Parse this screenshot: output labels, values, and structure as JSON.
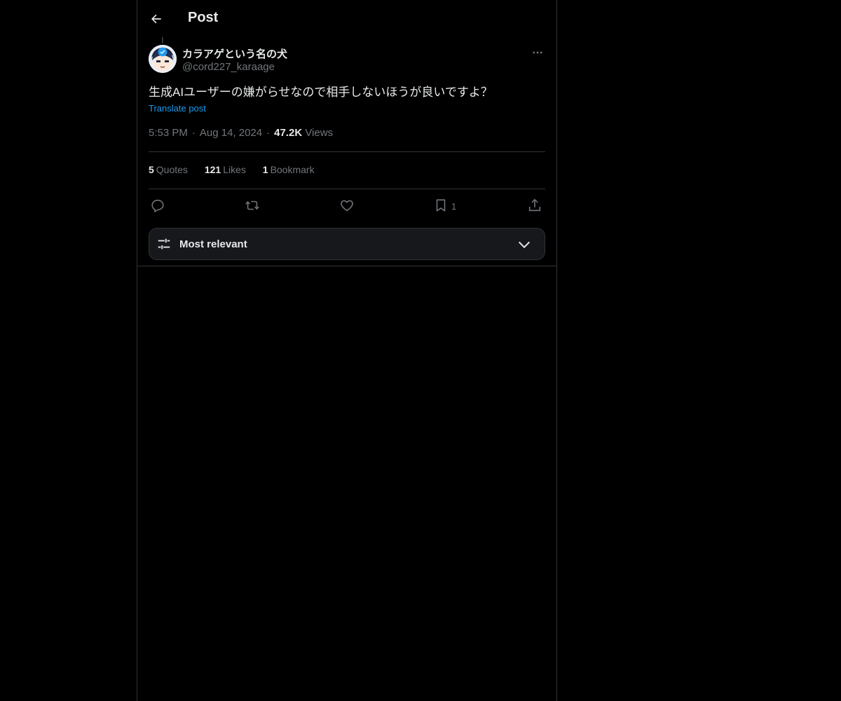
{
  "header": {
    "title": "Post",
    "back_icon": "arrow-left-icon"
  },
  "post": {
    "author_name": "カラアゲという名の犬",
    "author_handle": "@cord227_karaage",
    "verified": true,
    "text": "生成AIユーザーの嫌がらせなので相手しないほうが良いですよ？",
    "translate_label": "Translate post",
    "time": "5:53 PM",
    "date": "Aug 14, 2024",
    "views_count": "47.2K",
    "views_label": "Views"
  },
  "stats": {
    "quotes_count": "5",
    "quotes_label": "Quotes",
    "likes_count": "121",
    "likes_label": "Likes",
    "bookmarks_count": "1",
    "bookmarks_label": "Bookmark"
  },
  "actions": {
    "reply_icon": "reply-icon",
    "repost_icon": "repost-icon",
    "like_icon": "heart-icon",
    "bookmark_icon": "bookmark-icon",
    "bookmark_count": "1",
    "share_icon": "share-icon"
  },
  "sort": {
    "label": "Most relevant",
    "icon": "sliders-icon",
    "chevron": "chevron-down-icon"
  },
  "colors": {
    "background": "#000000",
    "text": "#e7e9ea",
    "muted": "#71767b",
    "accent": "#1d9bf0",
    "border": "#2f3336"
  }
}
